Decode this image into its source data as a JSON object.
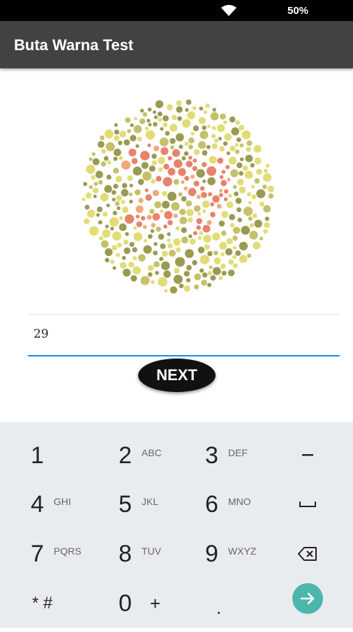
{
  "status": {
    "battery": "50%",
    "wifi_icon": "wifi-icon"
  },
  "app": {
    "title": "Buta Warna Test"
  },
  "plate": {
    "alt_icon": "ishihara-plate",
    "colors": {
      "olive": "#9b9a52",
      "yellow": "#e2dc76",
      "khaki": "#c6c06a",
      "red": "#e9826b",
      "orange": "#f2a878"
    }
  },
  "answer": {
    "value": "29"
  },
  "next_button": {
    "label": "NEXT"
  },
  "keyboard": {
    "rows": [
      [
        {
          "digit": "1",
          "letters": ""
        },
        {
          "digit": "2",
          "letters": "ABC"
        },
        {
          "digit": "3",
          "letters": "DEF"
        }
      ],
      [
        {
          "digit": "4",
          "letters": "GHI"
        },
        {
          "digit": "5",
          "letters": "JKL"
        },
        {
          "digit": "6",
          "letters": "MNO"
        }
      ],
      [
        {
          "digit": "7",
          "letters": "PQRS"
        },
        {
          "digit": "8",
          "letters": "TUV"
        },
        {
          "digit": "9",
          "letters": "WXYZ"
        }
      ]
    ],
    "bottom": {
      "star_hash": "* #",
      "zero": "0",
      "plus": "+",
      "period": "."
    },
    "icons": {
      "minus": "minus-icon",
      "space": "space-icon",
      "backspace": "backspace-icon",
      "go": "go-arrow-icon"
    },
    "accent_color": "#4db6ac"
  }
}
